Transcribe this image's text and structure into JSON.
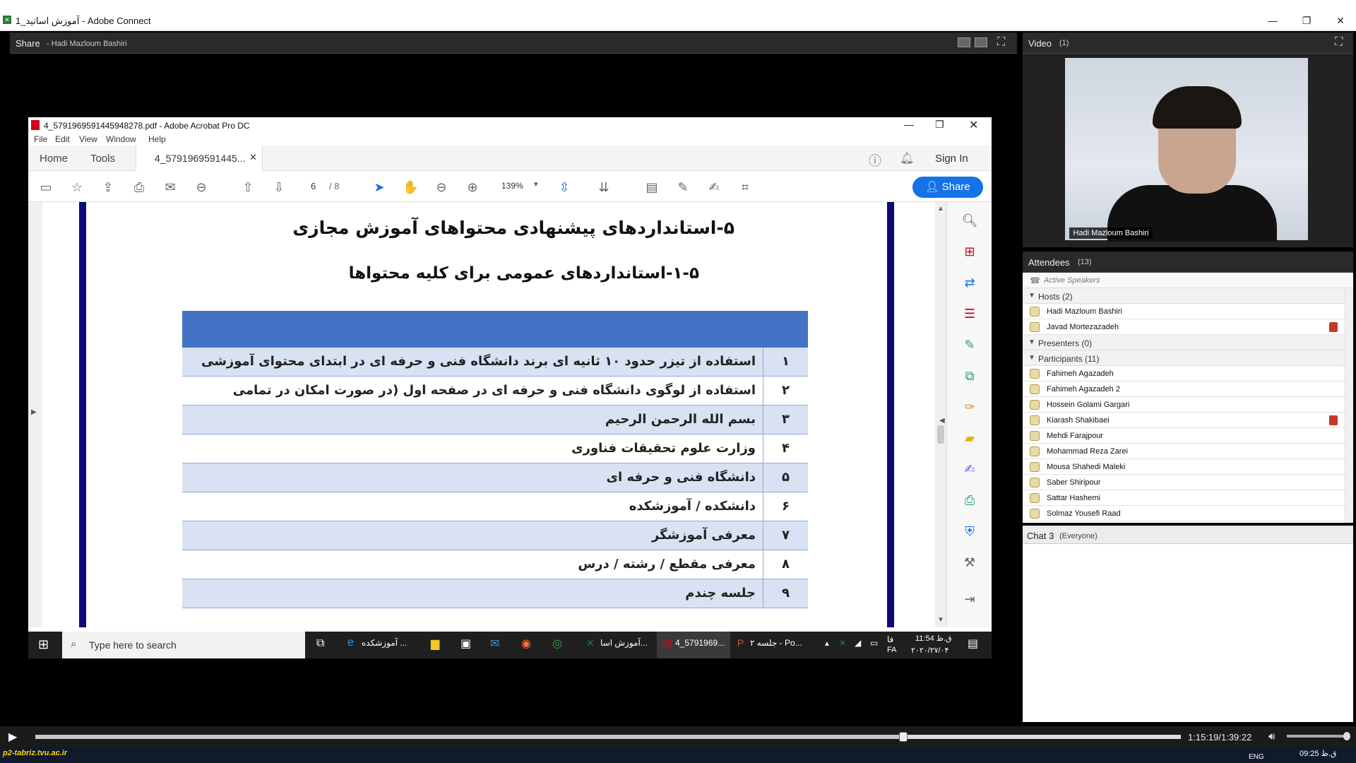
{
  "window": {
    "title": "آموزش اساتید_1 - Adobe Connect",
    "minimize": "—",
    "restore": "❐",
    "close": "✕"
  },
  "share_pod": {
    "title": "Share",
    "presenter": "- Hadi Mazloum Bashiri"
  },
  "acrobat": {
    "title": "4_5791969591445948278.pdf - Adobe Acrobat Pro DC",
    "menu": [
      "File",
      "Edit",
      "View",
      "Window",
      "Help"
    ],
    "tabs": {
      "home": "Home",
      "tools": "Tools",
      "doc": "4_5791969591445...",
      "sign_in": "Sign In"
    },
    "page_current": "6",
    "page_total": "/ 8",
    "zoom": "139%",
    "share_label": "Share"
  },
  "pdf": {
    "heading1": "۵-استانداردهای پیشنهادی محتواهای آموزش مجازی",
    "heading2": "۱-۵-استانداردهای عمومی برای کلیه محتواها",
    "rows": [
      {
        "num": "۱",
        "text": "استفاده از تیزر حدود ۱۰ ثانیه ای برند دانشگاه فنی و حرفه ای در ابتدای محتوای آموزشی"
      },
      {
        "num": "۲",
        "text": "استفاده از لوگوی دانشگاه فنی و حرفه ای در صفحه اول (در صورت امکان در تمامی صفحات)"
      },
      {
        "num": "۳",
        "text": "بسم الله الرحمن الرحیم"
      },
      {
        "num": "۴",
        "text": "وزارت علوم تحقیقات فناوری"
      },
      {
        "num": "۵",
        "text": "دانشگاه فنی و حرفه ای"
      },
      {
        "num": "۶",
        "text": "دانشکده / آموزشکده"
      },
      {
        "num": "۷",
        "text": "معرفی آموزشگر"
      },
      {
        "num": "۸",
        "text": "معرفی مقطع / رشته / درس"
      },
      {
        "num": "۹",
        "text": "جلسه چندم"
      }
    ]
  },
  "inner_taskbar": {
    "search_placeholder": "Type here to search",
    "items": [
      "آموزشکده ...",
      "آموزش اسا...",
      "4_5791969...",
      "جلسه ۲ - Po..."
    ],
    "time": "11:54 ق.ظ",
    "date": "۲۰۲۰/۲۷/۰۴",
    "lang": "FA",
    "lang2": "فا"
  },
  "video_pod": {
    "title": "Video",
    "count": "(1)",
    "name": "Hadi Mazloum Bashiri"
  },
  "attendees": {
    "title": "Attendees",
    "count": "(13)",
    "active_speakers": "Active Speakers",
    "hosts_label": "Hosts (2)",
    "hosts": [
      "Hadi Mazloum Bashiri",
      "Javad Mortezazadeh"
    ],
    "presenters_label": "Presenters (0)",
    "participants_label": "Participants (11)",
    "participants": [
      "Fahimeh Agazadeh",
      "Fahimeh Agazadeh 2",
      "Hossein Golami Gargari",
      "Kiarash Shakibaei",
      "Mehdi Farajpour",
      "Mohammad Reza Zarei",
      "Mousa Shahedi Maleki",
      "Saber Shiripour",
      "Sattar Hashemi",
      "Solmaz Yousefi Raad"
    ]
  },
  "chat_pod": {
    "title": "Chat 3",
    "scope": "(Everyone)"
  },
  "playback": {
    "time": "1:15:19/1:39:22",
    "progress": 0.758
  },
  "desktop_taskbar": {
    "url": "p2-tabriz.tvu.ac.ir",
    "lang": "ENG",
    "clock": "09:25 ق.ظ"
  },
  "colors": {
    "table_header": "#4472c4",
    "table_alt": "#d9e2f3",
    "page_border": "#0a0a7a",
    "share_button": "#1473e6"
  }
}
